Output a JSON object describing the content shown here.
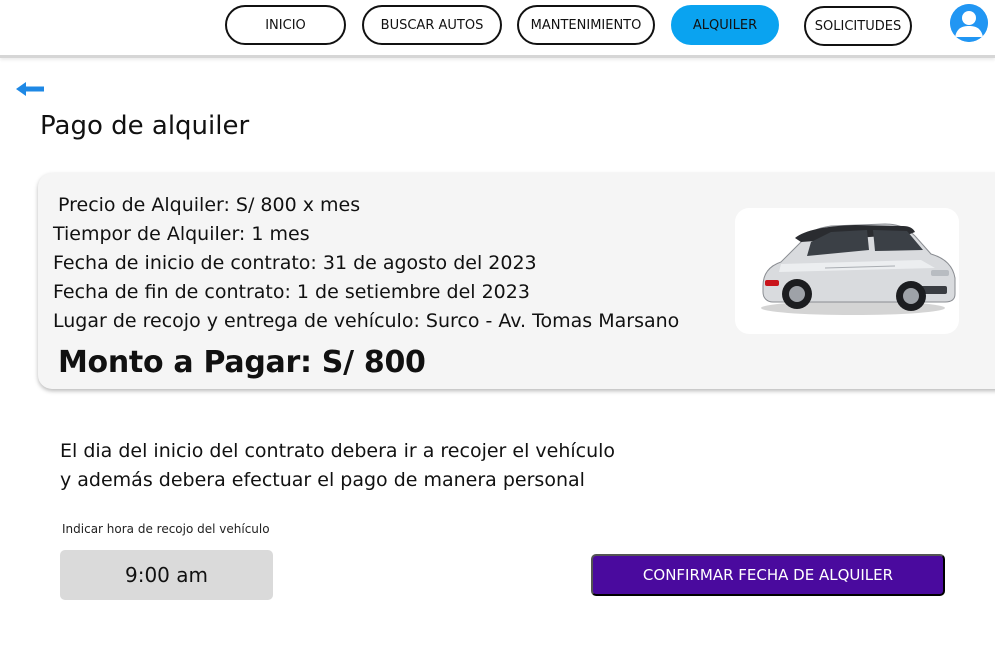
{
  "nav": {
    "items": [
      {
        "label": "INICIO",
        "active": false
      },
      {
        "label": "BUSCAR AUTOS",
        "active": false
      },
      {
        "label": "MANTENIMIENTO",
        "active": false
      },
      {
        "label": "ALQUILER",
        "active": true
      },
      {
        "label": "SOLICITUDES",
        "active": false
      }
    ],
    "avatar_icon": "user-avatar-icon"
  },
  "back_icon": "back-arrow-icon",
  "page": {
    "title": "Pago de alquiler"
  },
  "rental": {
    "price": "Precio de Alquiler:  S/ 800 x mes",
    "duration": "Tiempor de Alquiler: 1 mes",
    "start_date": "Fecha de inicio de contrato: 31 de agosto del 2023",
    "end_date": "Fecha de fin de contrato: 1 de setiembre del 2023",
    "location": "Lugar de recojo y entrega de vehículo: Surco - Av. Tomas Marsano",
    "total": "Monto a Pagar:  S/ 800"
  },
  "notice": {
    "line1": "El dia del inicio del contrato  debera ir a recojer el vehículo",
    "line2": "y además debera efectuar el pago de manera personal"
  },
  "pickup": {
    "label": "Indicar hora de recojo del vehículo",
    "time": "9:00 am"
  },
  "confirm_label": "CONFIRMAR FECHA DE ALQUILER",
  "colors": {
    "nav_active": "#0aa3f0",
    "confirm_button": "#4a0a9e",
    "back_arrow": "#1e88e5",
    "avatar": "#2196f3"
  }
}
